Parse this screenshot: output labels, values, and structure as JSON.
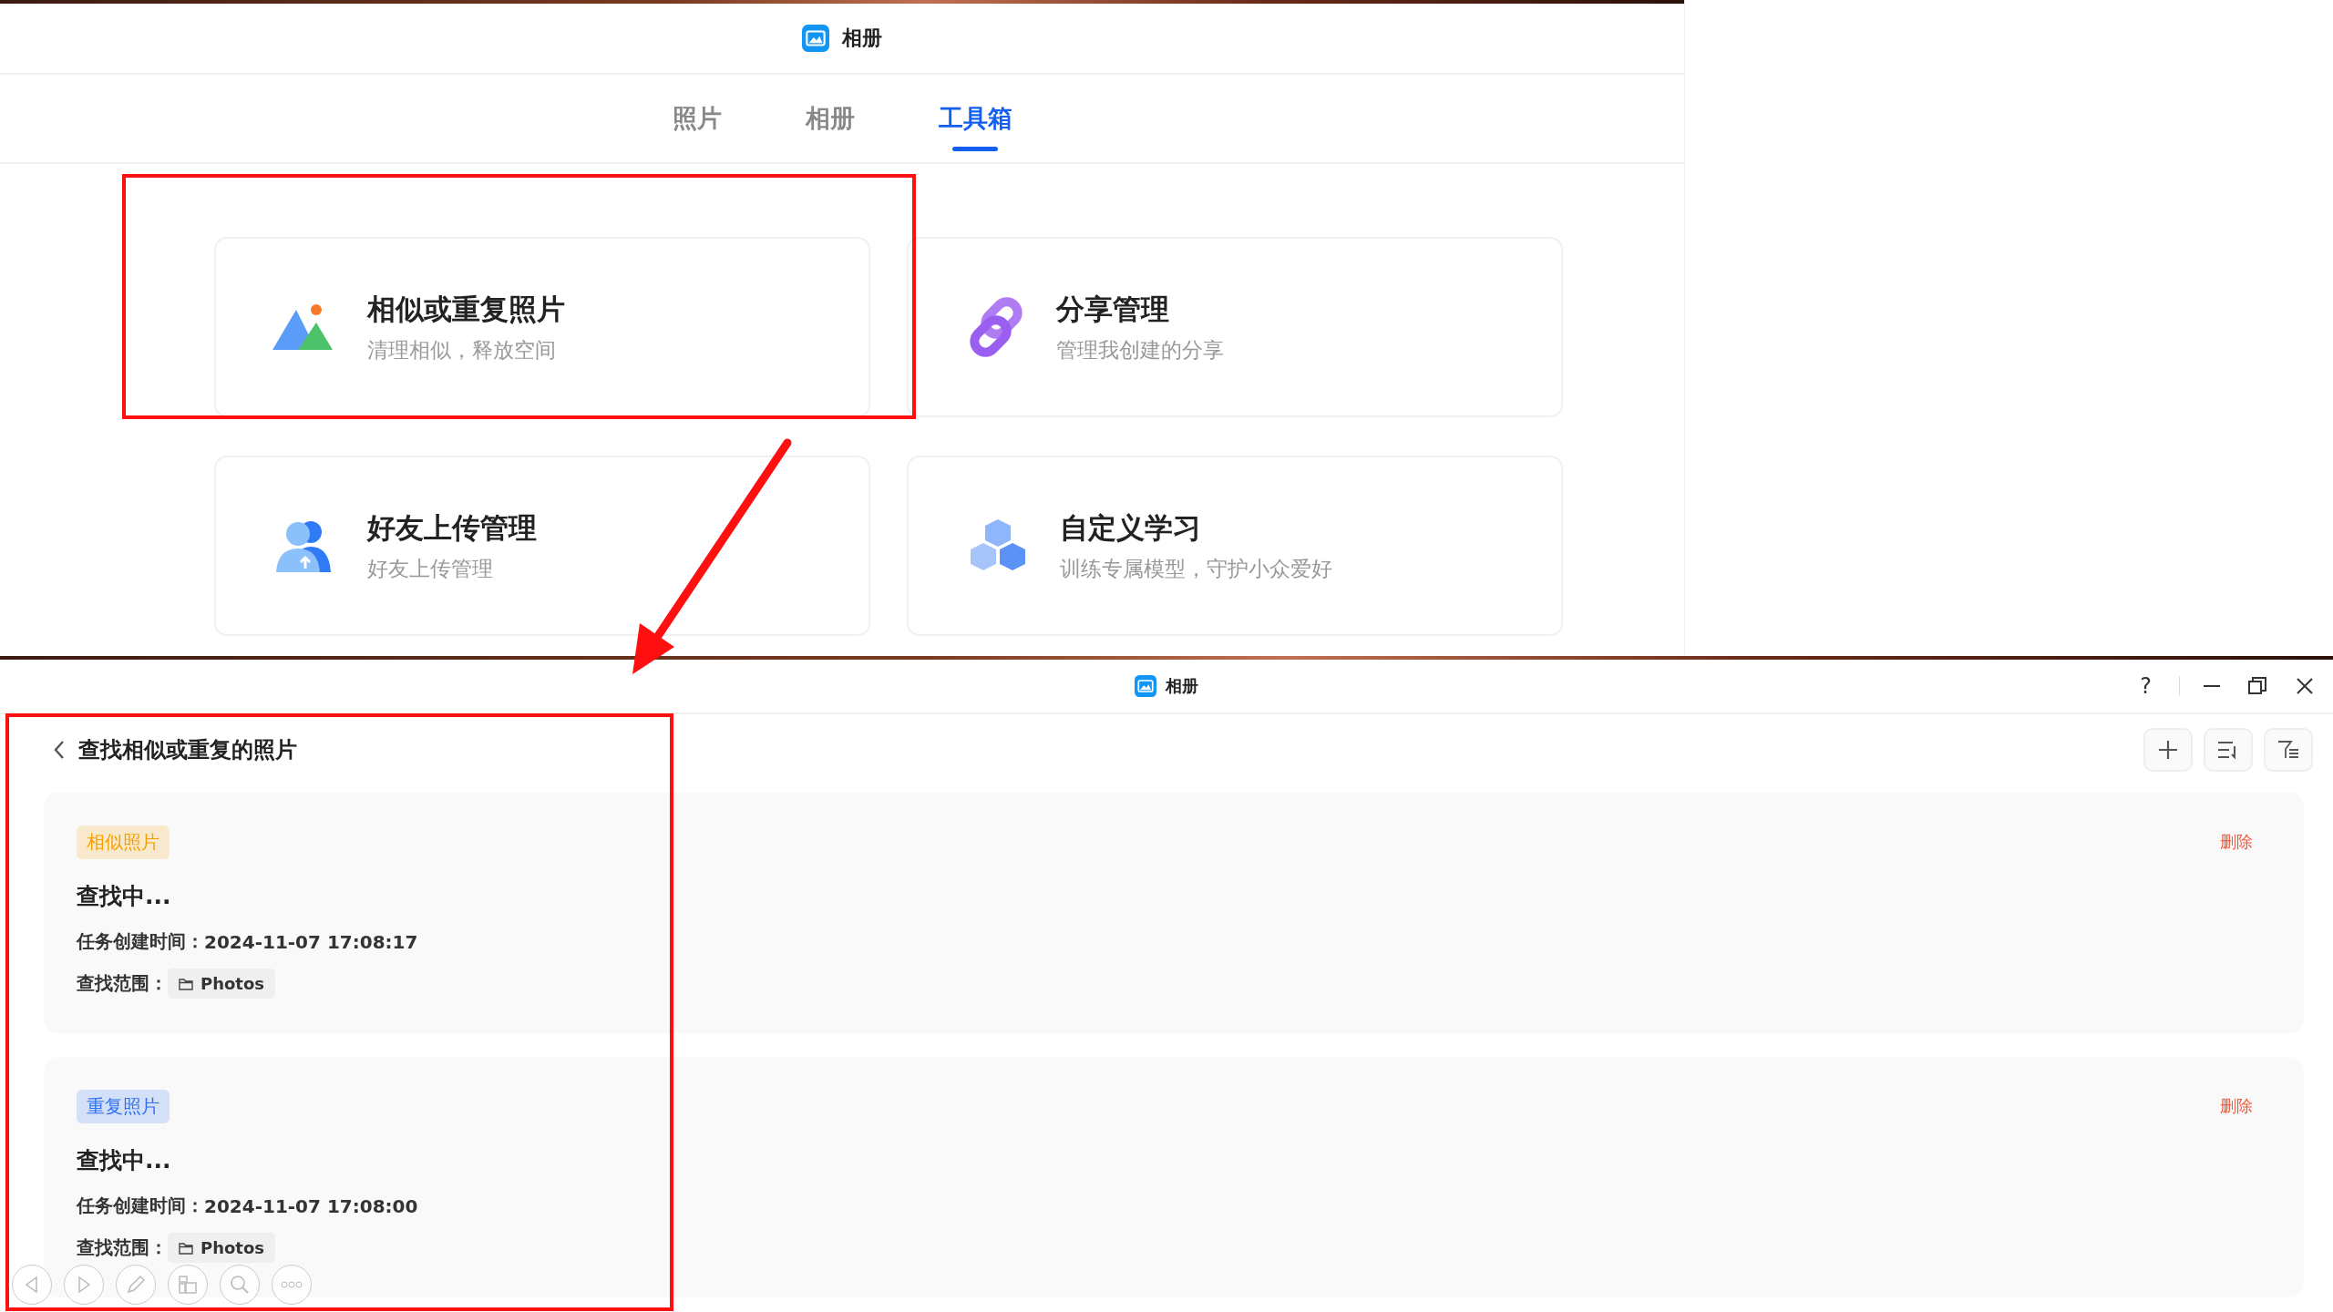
{
  "top_window": {
    "title": "相册",
    "tabs": [
      {
        "label": "照片",
        "selected": false
      },
      {
        "label": "相册",
        "selected": false
      },
      {
        "label": "工具箱",
        "selected": true
      }
    ],
    "tools": [
      {
        "kind": "similar",
        "title": "相似或重复照片",
        "subtitle": "清理相似，释放空间"
      },
      {
        "kind": "share",
        "title": "分享管理",
        "subtitle": "管理我创建的分享"
      },
      {
        "kind": "friends",
        "title": "好友上传管理",
        "subtitle": "好友上传管理"
      },
      {
        "kind": "learning",
        "title": "自定义学习",
        "subtitle": "训练专属模型，守护小众爱好"
      }
    ]
  },
  "bottom_window": {
    "title": "相册",
    "help": "?",
    "page_title": "查找相似或重复的照片",
    "tasks": [
      {
        "tag": "相似照片",
        "color": "#f5a000",
        "status": "查找中...",
        "created_label": "任务创建时间：",
        "created": "2024-11-07 17:08:17",
        "scope_label": "查找范围：",
        "scope": "Photos",
        "action": "删除"
      },
      {
        "tag": "重复照片",
        "color": "#2f6ff0",
        "status": "查找中...",
        "created_label": "任务创建时间：",
        "created": "2024-11-07 17:08:00",
        "scope_label": "查找范围：",
        "scope": "Photos",
        "action": "删除"
      }
    ]
  }
}
